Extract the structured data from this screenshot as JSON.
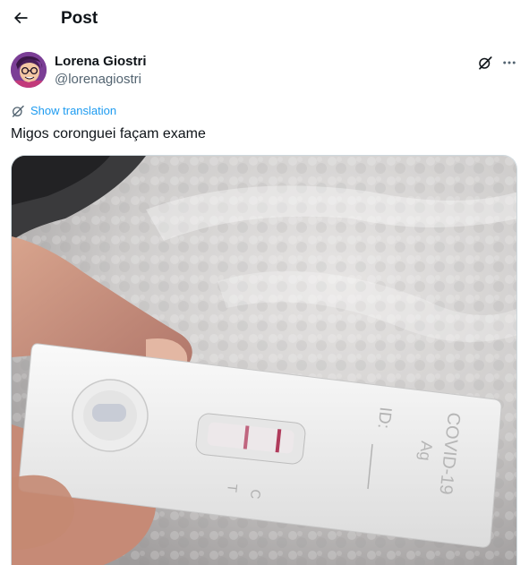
{
  "header": {
    "title": "Post",
    "back_icon": "arrow-left-icon"
  },
  "author": {
    "name": "Lorena Giostri",
    "handle": "@lorenagiostri",
    "avatar_icon": "avatar"
  },
  "actions": {
    "grok_icon": "grok-icon",
    "more_icon": "more-icon"
  },
  "translation": {
    "label": "Show translation",
    "icon": "translate-icon"
  },
  "post": {
    "text": "Migos coronguei façam exame"
  },
  "media": {
    "test_labels": {
      "c_label": "C",
      "t_label": "T",
      "id_label": "ID:",
      "product_line1": "COVID-19",
      "product_line2": "Ag"
    }
  },
  "colors": {
    "accent": "#1d9bf0",
    "text_primary": "#0f1419",
    "text_secondary": "#536471",
    "line_red": "#b03a5b"
  }
}
